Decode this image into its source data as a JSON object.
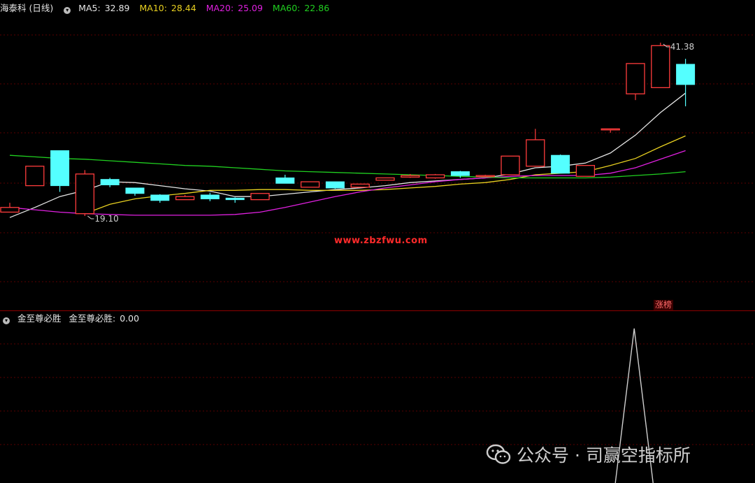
{
  "header": {
    "title": "海泰科 (日线)",
    "ma5": {
      "label": "MA5:",
      "value": "32.89",
      "color": "#e6e6e6"
    },
    "ma10": {
      "label": "MA10:",
      "value": "28.44",
      "color": "#e8d020"
    },
    "ma20": {
      "label": "MA20:",
      "value": "25.09",
      "color": "#e020e0"
    },
    "ma60": {
      "label": "MA60:",
      "value": "22.86",
      "color": "#20d020"
    }
  },
  "watermark": "www.zbzfwu.com",
  "badge": "涨榜",
  "indicator": {
    "title": "金至尊必胜",
    "label": "金至尊必胜:",
    "value": "0.00"
  },
  "footer": {
    "wechat": "公众号 · 司赢空指标所",
    "icon": "wechat-icon"
  },
  "chart_data": [
    {
      "type": "candlestick",
      "title": "海泰科 (日线)",
      "ylim": [
        18.0,
        43.0
      ],
      "grid": true,
      "annotations": [
        {
          "text": "41.38",
          "type": "high-marker",
          "candle_index": 26
        },
        {
          "text": "19.10",
          "type": "low-marker",
          "candle_index": 3
        }
      ],
      "candles": [
        {
          "open": 19.6,
          "close": 20.2,
          "high": 20.8,
          "low": 19.6
        },
        {
          "open": 23.0,
          "close": 25.5,
          "high": 25.5,
          "low": 23.0
        },
        {
          "open": 27.5,
          "close": 23.0,
          "high": 27.5,
          "low": 22.2
        },
        {
          "open": 19.4,
          "close": 24.5,
          "high": 25.0,
          "low": 19.1
        },
        {
          "open": 23.8,
          "close": 23.1,
          "high": 24.0,
          "low": 22.8
        },
        {
          "open": 22.7,
          "close": 22.0,
          "high": 22.7,
          "low": 21.7
        },
        {
          "open": 21.8,
          "close": 21.1,
          "high": 21.9,
          "low": 20.8
        },
        {
          "open": 21.2,
          "close": 21.6,
          "high": 21.8,
          "low": 21.2
        },
        {
          "open": 21.8,
          "close": 21.3,
          "high": 22.1,
          "low": 21.0
        },
        {
          "open": 21.4,
          "close": 21.2,
          "high": 21.5,
          "low": 20.8
        },
        {
          "open": 21.2,
          "close": 22.0,
          "high": 22.0,
          "low": 21.2
        },
        {
          "open": 24.0,
          "close": 23.3,
          "high": 24.4,
          "low": 23.3
        },
        {
          "open": 22.8,
          "close": 23.5,
          "high": 23.5,
          "low": 22.8
        },
        {
          "open": 23.5,
          "close": 22.7,
          "high": 23.5,
          "low": 22.6
        },
        {
          "open": 22.8,
          "close": 23.2,
          "high": 23.2,
          "low": 22.8
        },
        {
          "open": 23.7,
          "close": 24.0,
          "high": 24.0,
          "low": 23.7
        },
        {
          "open": 24.1,
          "close": 24.3,
          "high": 24.5,
          "low": 24.0
        },
        {
          "open": 24.0,
          "close": 24.4,
          "high": 24.5,
          "low": 23.9
        },
        {
          "open": 24.8,
          "close": 24.3,
          "high": 24.9,
          "low": 24.0
        },
        {
          "open": 24.2,
          "close": 24.3,
          "high": 24.4,
          "low": 24.1
        },
        {
          "open": 24.4,
          "close": 26.8,
          "high": 26.8,
          "low": 24.4
        },
        {
          "open": 25.5,
          "close": 28.9,
          "high": 30.3,
          "low": 25.5
        },
        {
          "open": 26.9,
          "close": 24.6,
          "high": 27.0,
          "low": 24.6
        },
        {
          "open": 24.2,
          "close": 25.6,
          "high": 25.6,
          "low": 24.2
        },
        {
          "open": 30.3,
          "close": 30.3,
          "high": 30.3,
          "low": 29.8
        },
        {
          "open": 34.8,
          "close": 38.7,
          "high": 38.7,
          "low": 34.0
        },
        {
          "open": 35.6,
          "close": 41.0,
          "high": 41.38,
          "low": 35.6
        },
        {
          "open": 38.6,
          "close": 36.0,
          "high": 39.3,
          "low": 33.2
        }
      ],
      "series": [
        {
          "name": "MA5",
          "color": "#e6e6e6",
          "values": [
            18.9,
            20.2,
            21.6,
            22.4,
            23.5,
            23.4,
            23.0,
            22.6,
            22.3,
            21.6,
            21.6,
            21.9,
            22.2,
            22.5,
            22.7,
            23.0,
            23.4,
            23.6,
            23.8,
            24.0,
            24.5,
            25.3,
            25.5,
            25.9,
            27.2,
            29.5,
            32.4,
            34.9
          ]
        },
        {
          "name": "MA10",
          "color": "#e8d020",
          "values": [
            null,
            null,
            null,
            19.4,
            20.6,
            21.3,
            21.7,
            22.0,
            22.4,
            22.4,
            22.5,
            22.5,
            22.4,
            22.4,
            22.4,
            22.5,
            22.7,
            22.9,
            23.2,
            23.4,
            23.8,
            24.4,
            24.6,
            24.8,
            25.6,
            26.5,
            28.0,
            29.4
          ]
        },
        {
          "name": "MA20",
          "color": "#e020e0",
          "values": [
            20.2,
            19.9,
            19.6,
            19.4,
            19.3,
            19.2,
            19.2,
            19.2,
            19.2,
            19.3,
            19.6,
            20.2,
            20.9,
            21.6,
            22.2,
            22.7,
            23.1,
            23.5,
            23.8,
            24.0,
            24.2,
            24.3,
            24.3,
            24.3,
            24.6,
            25.3,
            26.4,
            27.5
          ]
        },
        {
          "name": "MA60",
          "color": "#20d020",
          "values": [
            26.9,
            26.7,
            26.5,
            26.4,
            26.2,
            26.0,
            25.8,
            25.6,
            25.5,
            25.3,
            25.1,
            24.9,
            24.8,
            24.7,
            24.6,
            24.5,
            24.4,
            24.3,
            24.2,
            24.1,
            24.0,
            24.0,
            24.0,
            24.0,
            24.1,
            24.3,
            24.5,
            24.8
          ]
        }
      ]
    },
    {
      "type": "line",
      "title": "金至尊必胜",
      "ylim": [
        0,
        1
      ],
      "grid": true,
      "series": [
        {
          "name": "金至尊必胜",
          "color": "#cfcfcf",
          "values": [
            0,
            0,
            0,
            0,
            0,
            0,
            0,
            0,
            0,
            0,
            0,
            0,
            0,
            0,
            0,
            0,
            0,
            0,
            0,
            0,
            0,
            0,
            0,
            0,
            0,
            1,
            0,
            0
          ]
        }
      ]
    }
  ]
}
